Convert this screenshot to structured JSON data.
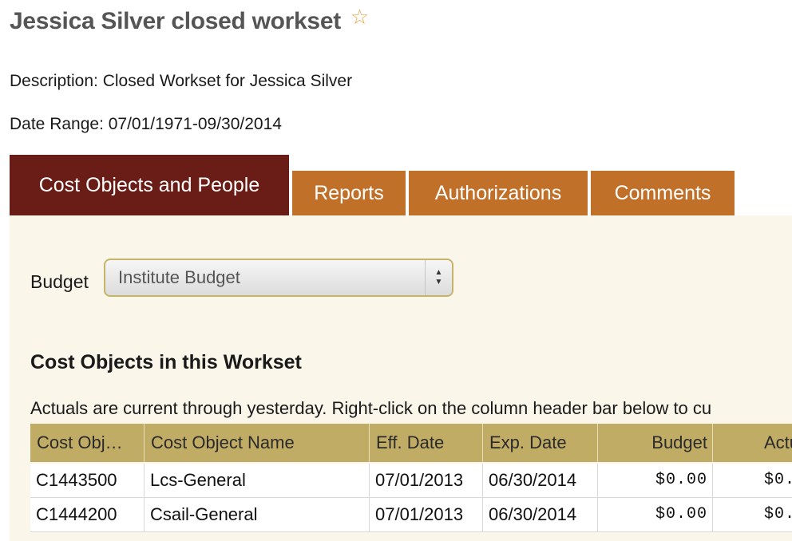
{
  "page": {
    "title": "Jessica Silver closed workset",
    "favorite_icon": "star-outline-icon",
    "description": "Description: Closed Workset for Jessica Silver",
    "date_range": "Date Range: 07/01/1971-09/30/2014"
  },
  "colors": {
    "active_tab": "#6a1d17",
    "inactive_tab": "#c1702a",
    "table_header": "#c1ac66",
    "panel_background": "#faf6ea",
    "star": "#e3a64a"
  },
  "tabs": [
    {
      "label": "Cost Objects and People",
      "active": true
    },
    {
      "label": "Reports",
      "active": false
    },
    {
      "label": "Authorizations",
      "active": false
    },
    {
      "label": "Comments",
      "active": false
    }
  ],
  "budget": {
    "label": "Budget",
    "selected": "Institute Budget"
  },
  "cost_objects": {
    "heading": "Cost Objects in this Workset",
    "note": "Actuals are current through yesterday. Right-click on the column header bar below to cu",
    "columns": [
      "Cost Obj…",
      "Cost Object Name",
      "Eff. Date",
      "Exp. Date",
      "Budget",
      "Actu"
    ],
    "rows": [
      [
        "C1443500",
        "Lcs-General",
        "07/01/2013",
        "06/30/2014",
        "$0.00",
        "$0."
      ],
      [
        "C1444200",
        "Csail-General",
        "07/01/2013",
        "06/30/2014",
        "$0.00",
        "$0."
      ]
    ]
  }
}
